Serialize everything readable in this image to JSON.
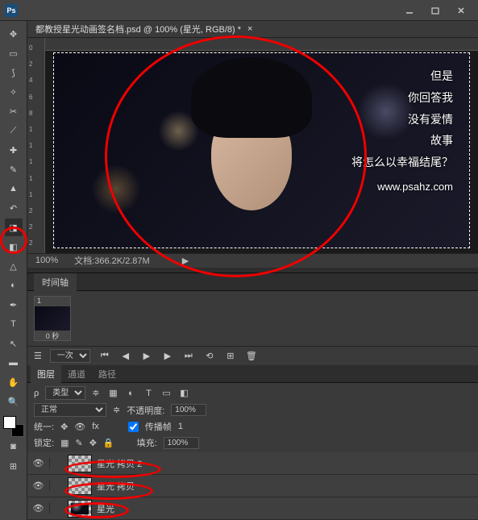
{
  "titlebar": {
    "app_icon": "Ps"
  },
  "document": {
    "title": "都教授星光动画签名档.psd @ 100% (星光, RGB/8) *"
  },
  "canvas": {
    "poem_lines": [
      "但是",
      "你回答我",
      "没有爱情",
      "故事",
      "将怎么以幸福结尾？"
    ],
    "url": "www.psahz.com"
  },
  "status": {
    "zoom": "100%",
    "doc_info_label": "文档:",
    "doc_info": "366.2K/2.87M"
  },
  "ruler_v": [
    "0",
    "2",
    "4",
    "6",
    "8",
    "1",
    "1",
    "1",
    "1",
    "1",
    "2",
    "2",
    "2",
    "2"
  ],
  "timeline": {
    "tab": "时间轴",
    "frame_num": "1",
    "frame_duration": "0 秒",
    "loop": "一次"
  },
  "layers": {
    "tabs": [
      "图层",
      "通道",
      "路径"
    ],
    "kind": "类型",
    "blend": "正常",
    "opacity_label": "不透明度:",
    "opacity": "100%",
    "unify_label": "统一:",
    "propagate_label": "传播帧",
    "propagate_value": "1",
    "lock_label": "锁定:",
    "fill_label": "填充:",
    "fill": "100%",
    "items": [
      {
        "name": "星光 拷贝 2"
      },
      {
        "name": "星光 拷贝"
      },
      {
        "name": "星光"
      }
    ]
  }
}
